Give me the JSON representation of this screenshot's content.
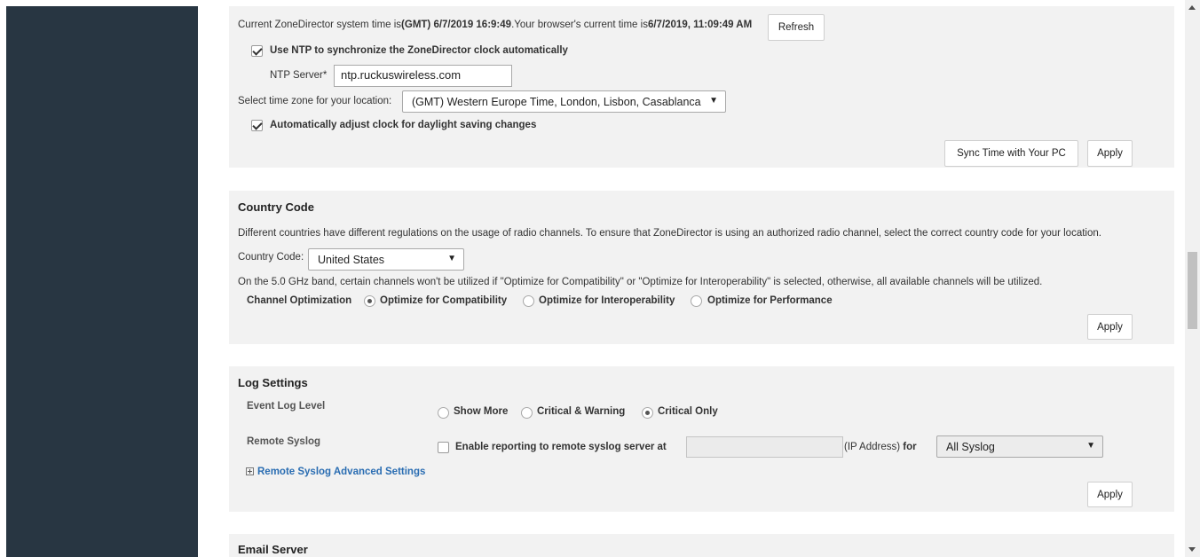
{
  "system_time": {
    "prefix": "Current ZoneDirector system time is",
    "zd_time": "(GMT) 6/7/2019 16:9:49",
    "browser_prefix": ".Your browser's current time is",
    "browser_time": "6/7/2019, 11:09:49 AM",
    "refresh_label": "Refresh",
    "ntp_checkbox_label": "Use NTP to synchronize the ZoneDirector clock automatically",
    "ntp_checked": true,
    "ntp_server_label": "NTP Server*",
    "ntp_server_value": "ntp.ruckuswireless.com",
    "timezone_label": "Select time zone for your location:",
    "timezone_value": "(GMT) Western Europe Time, London, Lisbon, Casablanca",
    "dst_checkbox_label": "Automatically adjust clock for daylight saving changes",
    "dst_checked": true,
    "sync_button_label": "Sync Time with Your PC",
    "apply_label": "Apply"
  },
  "country_code": {
    "title": "Country Code",
    "description": "Different countries have different regulations on the usage of radio channels. To ensure that ZoneDirector is using an authorized radio channel, select the correct country code for your location.",
    "label": "Country Code:",
    "value": "United States",
    "note": "On the 5.0 GHz band, certain channels won't be utilized if \"Optimize for Compatibility\" or \"Optimize for Interoperability\" is selected, otherwise, all available channels will be utilized.",
    "optimization_label": "Channel Optimization",
    "options": [
      "Optimize for Compatibility",
      "Optimize for Interoperability",
      "Optimize for Performance"
    ],
    "selected_option": "Optimize for Compatibility",
    "apply_label": "Apply"
  },
  "log_settings": {
    "title": "Log Settings",
    "event_log_label": "Event Log Level",
    "event_log_options": [
      "Show More",
      "Critical & Warning",
      "Critical Only"
    ],
    "event_log_selected": "Critical Only",
    "remote_syslog_label": "Remote Syslog",
    "remote_syslog_checkbox_label": "Enable reporting to remote syslog server at",
    "remote_syslog_checked": false,
    "ip_address_value": "",
    "ip_suffix": "(IP Address)",
    "for_label": "for",
    "syslog_select_value": "All Syslog",
    "advanced_link": "Remote Syslog Advanced Settings",
    "apply_label": "Apply"
  },
  "email_server": {
    "title": "Email Server"
  },
  "icons": {
    "dropdown": "▼"
  },
  "colors": {
    "sidebar": "#283642",
    "panel": "#f2f2f2",
    "link": "#2a6db2"
  }
}
